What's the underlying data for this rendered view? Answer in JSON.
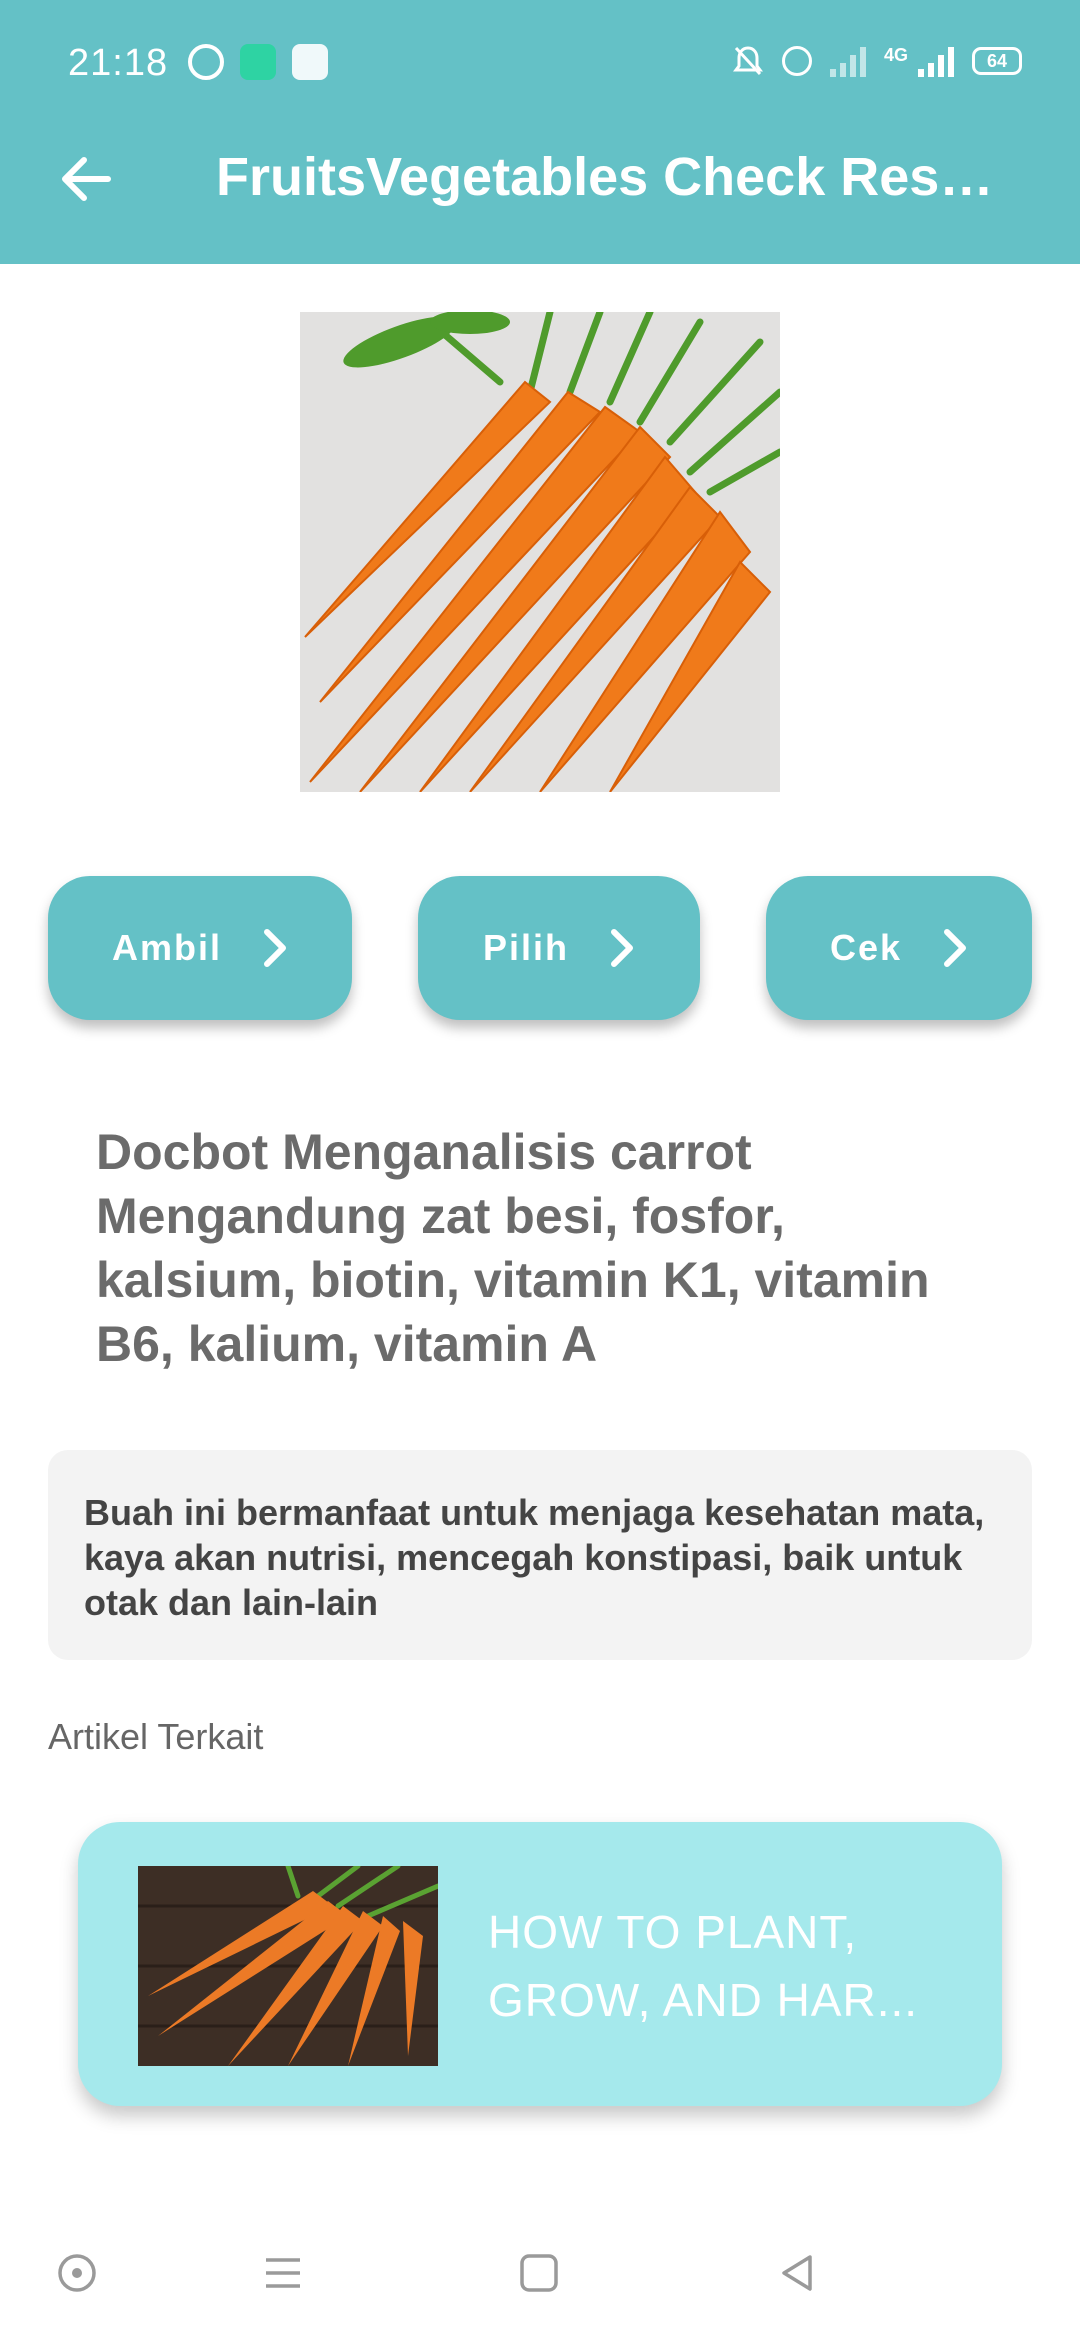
{
  "status_bar": {
    "time": "21:18",
    "network": "4G",
    "battery": "64",
    "icons": [
      "whatsapp-icon",
      "chat-app-icon",
      "webtoon-icon",
      "mute-icon",
      "alarm-icon",
      "signal-icon",
      "signal-4g-icon",
      "battery-icon"
    ]
  },
  "app_bar": {
    "title": "FruitsVegetables Check Resul..."
  },
  "actions": {
    "take_label": "Ambil",
    "pick_label": "Pilih",
    "check_label": "Cek"
  },
  "result": {
    "analysis_text": "Docbot Menganalisis carrot Mengandung zat besi, fosfor, kalsium, biotin, vitamin K1, vitamin B6, kalium, vitamin A",
    "benefit_text": "Buah ini bermanfaat untuk menjaga kesehatan mata, kaya akan nutrisi, mencegah konstipasi, baik untuk otak dan lain-lain"
  },
  "related": {
    "heading": "Artikel Terkait",
    "items": [
      {
        "title": "HOW TO PLANT, GROW, AND HAR..."
      }
    ]
  },
  "colors": {
    "primary": "#64c1c6",
    "card": "#a5e9ec",
    "carrot": "#f07a1a"
  }
}
